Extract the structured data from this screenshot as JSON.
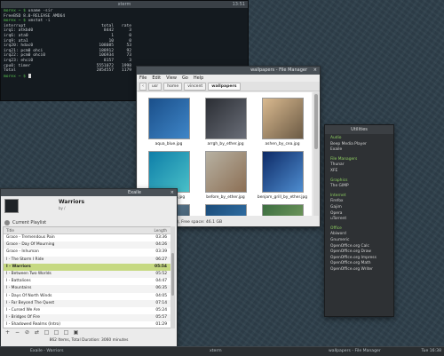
{
  "terminal": {
    "title": "xterm",
    "title_right": "13:51",
    "lines": [
      {
        "prompt": "morex ~ $",
        "text": " uname -sir"
      },
      {
        "prompt": "",
        "text": "FreeBSD 8.0-RELEASE AMD64"
      },
      {
        "prompt": "morex ~ $",
        "text": " vmstat -i"
      }
    ],
    "table": [
      [
        "interrupt",
        "total",
        "rate"
      ],
      [
        "irq1: atkbd0",
        "8442",
        "3"
      ],
      [
        "irq6: ata0",
        "1",
        "0"
      ],
      [
        "irq9: ata1",
        "10",
        "0"
      ],
      [
        "irq20: hdac0",
        "108085",
        "53"
      ],
      [
        "irq21: pcm0 ohci",
        "188912",
        "92"
      ],
      [
        "irq22: pcm0 ohci0",
        "106934",
        "73"
      ],
      [
        "irq23: ehci0",
        "8157",
        "3"
      ],
      [
        "cpu0: timer",
        "5551072",
        "1998"
      ],
      [
        "Total",
        "2854557",
        "1179"
      ]
    ],
    "last_prompt": "morex ~ $"
  },
  "file_manager": {
    "title": "wallpapers - File Manager",
    "close_glyph": "×",
    "menu": [
      "File",
      "Edit",
      "View",
      "Go",
      "Help"
    ],
    "breadcrumbs": [
      "usr",
      "home",
      "vincent",
      "wallpapers"
    ],
    "items": [
      {
        "label": "aqua_blue.jpg",
        "swatch": [
          "#1a4f8a",
          "#3f86c8"
        ]
      },
      {
        "label": "arrgh_by_ether.jpg",
        "swatch": [
          "#2b2e34",
          "#6a6e78"
        ]
      },
      {
        "label": "ashen_by_cea.jpg",
        "swatch": [
          "#d9b98f",
          "#6b5a44"
        ]
      },
      {
        "label": "aurora-water.jpg",
        "swatch": [
          "#0e7ea8",
          "#49c0c8"
        ]
      },
      {
        "label": "before_by_ether.jpg",
        "swatch": [
          "#b7b1a2",
          "#8c6f54"
        ]
      },
      {
        "label": "benjam_grill_by_ether.jpg",
        "swatch": [
          "#0d2a66",
          "#4e8dd0"
        ]
      },
      {
        "label": "",
        "swatch": [
          "#6a8aa2",
          "#324a5c"
        ]
      },
      {
        "label": "",
        "swatch": [
          "#1b4c7a",
          "#3a7db5"
        ]
      },
      {
        "label": "",
        "swatch": [
          "#3c6e40",
          "#86a868"
        ]
      }
    ],
    "status": "80 items (24.5 MiB), Free space: 46.1 GB"
  },
  "player": {
    "window_title": "Exaile",
    "close_glyph": "×",
    "now_playing_title": "Warriors",
    "now_playing_sub": "by /",
    "playlist_title": "Current Playlist",
    "col_title": "Title",
    "col_length": "Length",
    "tracks": [
      {
        "title": "Grace - Tremendous Pain",
        "length": "03:36",
        "playing": false
      },
      {
        "title": "Grace - Day Of Mourning",
        "length": "04:26",
        "playing": false
      },
      {
        "title": "Grace - Inhuman",
        "length": "03:39",
        "playing": false
      },
      {
        "title": "I - The Storm I Ride",
        "length": "06:27",
        "playing": false
      },
      {
        "title": "I - Warriors",
        "length": "05:54",
        "playing": true
      },
      {
        "title": "I - Between Two Worlds",
        "length": "05:52",
        "playing": false
      },
      {
        "title": "I - Battalions",
        "length": "04:47",
        "playing": false
      },
      {
        "title": "I - Mountains",
        "length": "06:35",
        "playing": false
      },
      {
        "title": "I - Days Of North Winds",
        "length": "04:05",
        "playing": false
      },
      {
        "title": "I - Far Beyond The Quest",
        "length": "07:14",
        "playing": false
      },
      {
        "title": "I - Cursed We Are",
        "length": "05:24",
        "playing": false
      },
      {
        "title": "I - Bridges Of Fire",
        "length": "05:57",
        "playing": false
      },
      {
        "title": "I - Shadowed Realms (Intro)",
        "length": "01:29",
        "playing": false
      }
    ],
    "toolbar": [
      "+",
      "−",
      "⊘",
      "⇄",
      "□",
      "□",
      "□",
      "▣"
    ],
    "status": "862 Items, Total Duration: 3060 minutes"
  },
  "menu": {
    "title": "Utilities",
    "groups": [
      {
        "category": "Audio",
        "items": [
          "Beep Media Player",
          "Exaile"
        ]
      },
      {
        "category": "File Managers",
        "items": [
          "Thunar",
          "XFE"
        ]
      },
      {
        "category": "Graphics",
        "items": [
          "The GIMP"
        ]
      },
      {
        "category": "Internet",
        "items": [
          "Firefox",
          "Gajim",
          "Opera",
          "uTorrent"
        ]
      },
      {
        "category": "Office",
        "items": [
          "Abiword",
          "Gnumeric",
          "OpenOffice.org Calc",
          "OpenOffice.org Draw",
          "OpenOffice.org Impress",
          "OpenOffice.org Math",
          "OpenOffice.org Writer"
        ]
      }
    ]
  },
  "taskbar": {
    "left": "Exaile - Warriors",
    "center": "xterm",
    "right_app": "wallpapers - File Manager",
    "clock": "Tue 16:38"
  }
}
